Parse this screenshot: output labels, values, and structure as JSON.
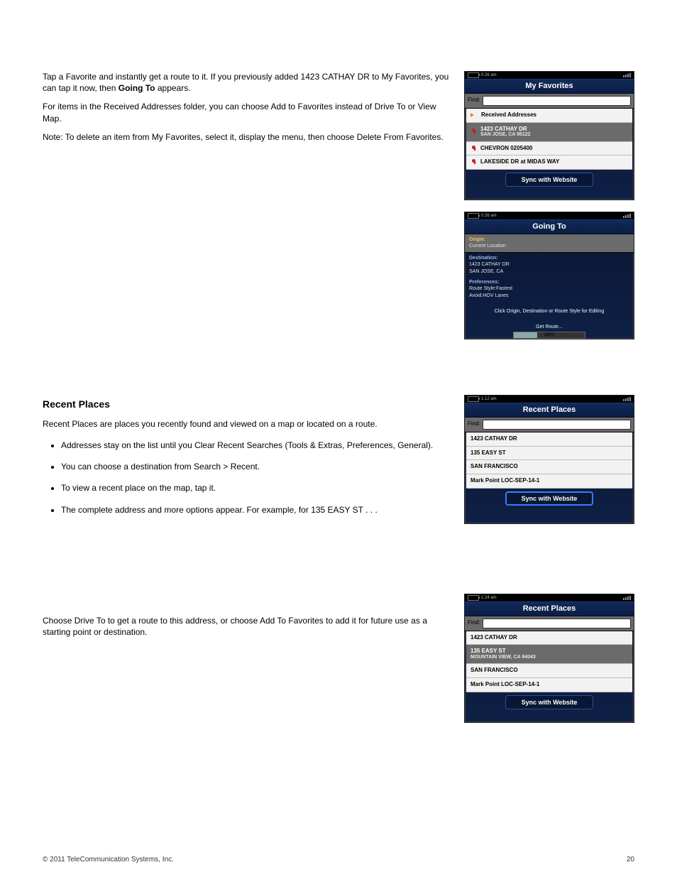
{
  "intro": {
    "para1_a": "Tap a Favorite and instantly get a route to it. If you previously added 1423 CATHAY DR to My Favorites, you can tap it now, then ",
    "para1_b": " appears.",
    "going_to_name": "Going To",
    "para2": "For items in the Received Addresses folder, you can choose Add to Favorites instead of Drive To or View Map.",
    "para3": "Note: To delete an item from My Favorites, select it, display the menu, then choose Delete From Favorites."
  },
  "recent": {
    "heading": "Recent Places",
    "para1": "Recent Places are places you recently found and viewed on a map or located on a route.",
    "bullets": [
      "Addresses stay on the list until you Clear Recent Searches (Tools & Extras, Preferences, General).",
      "You can choose a destination from Search > Recent.",
      "To view a recent place on the map, tap it.",
      "The complete address and more options appear. For example, for 135 EASY ST . . ."
    ],
    "para2": "Choose Drive To to get a route to this address, or choose Add To Favorites to add it for future use as a starting point or destination."
  },
  "screens": {
    "favorites": {
      "statusbar_time": "0:26 am",
      "title": "My Favorites",
      "find_label": "Find:",
      "rows": [
        {
          "label": "Received Addresses",
          "icon": "arrow"
        },
        {
          "label": "1423 CATHAY DR",
          "sub": "SAN JOSE, CA 95122",
          "icon": "pin",
          "selected": true
        },
        {
          "label": "CHEVRON 0205400",
          "icon": "pin"
        },
        {
          "label": "LAKESIDE DR at MIDAS WAY",
          "icon": "pin"
        }
      ],
      "button": "Sync with Website"
    },
    "going_to": {
      "statusbar_time": "0:26 am",
      "title": "Going To",
      "origin_hdr": "Origin:",
      "origin_val": "Current Location",
      "dest_hdr": "Destination:",
      "dest_l1": "1423 CATHAY DR",
      "dest_l2": "SAN JOSE, CA",
      "pref_hdr": "Preferences:",
      "pref_l1": "Route Style:Fastest",
      "pref_l2": "Avoid:HOV Lanes",
      "instruction": "Click Origin, Destination or Route Style for Editing",
      "progress_label": "Get Route...",
      "progress_value": "33%",
      "progress_pct": 33
    },
    "recent1": {
      "statusbar_time": "1:12 am",
      "title": "Recent Places",
      "find_label": "Find:",
      "rows": [
        {
          "label": "1423 CATHAY DR"
        },
        {
          "label": "135 EASY ST"
        },
        {
          "label": "SAN FRANCISCO"
        },
        {
          "label": "Mark Point LOC-SEP-14-1"
        }
      ],
      "button": "Sync with Website",
      "button_selected": true
    },
    "recent2": {
      "statusbar_time": "1:24 am",
      "title": "Recent Places",
      "find_label": "Find:",
      "rows": [
        {
          "label": "1423 CATHAY DR"
        },
        {
          "label": "135 EASY ST",
          "sub": "MOUNTAIN VIEW, CA 94043",
          "selected": true
        },
        {
          "label": "SAN FRANCISCO"
        },
        {
          "label": "Mark Point LOC-SEP-14-1"
        }
      ],
      "button": "Sync with Website"
    }
  },
  "footer": {
    "left": "© 2011 TeleCommunication Systems, Inc.",
    "right": "20"
  }
}
